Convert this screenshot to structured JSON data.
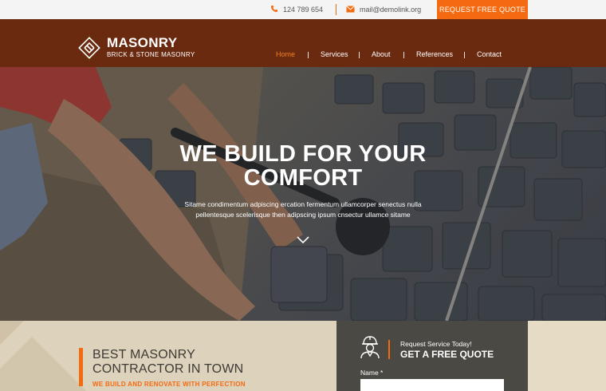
{
  "topbar": {
    "phone": "124 789 654",
    "email": "mail@demolink.org",
    "quote_button": "REQUEST FREE QUOTE"
  },
  "header": {
    "logo_title": "MASONRY",
    "logo_subtitle": "BRICK & STONE MASONRY",
    "nav": [
      {
        "label": "Home",
        "active": true
      },
      {
        "label": "Services"
      },
      {
        "label": "About"
      },
      {
        "label": "References"
      },
      {
        "label": "Contact"
      }
    ]
  },
  "hero": {
    "title_line1": "WE BUILD FOR YOUR",
    "title_line2": "COMFORT",
    "text_line1": "Sitame condimentum adpiscing ercation fermentum ullamcorper senectus nulla",
    "text_line2": "pellentesque scelerisque then adipscing ipsum cnsectur ullamce sitame"
  },
  "intro": {
    "title_line1": "BEST MASONRY",
    "title_line2": "CONTRACTOR IN TOWN",
    "subtitle": "WE BUILD AND RENOVATE WITH PERFECTION"
  },
  "quote_form": {
    "small_heading": "Request Service Today!",
    "big_heading": "GET A FREE QUOTE",
    "name_label": "Name *",
    "name_value": ""
  },
  "colors": {
    "accent": "#f46a10",
    "header_bg": "#6a2a10",
    "form_bg": "#4b4944",
    "section_bg": "#e6dcc6"
  },
  "icons": [
    "phone-icon",
    "mail-icon",
    "logo-icon",
    "chevron-down-icon",
    "worker-icon"
  ]
}
